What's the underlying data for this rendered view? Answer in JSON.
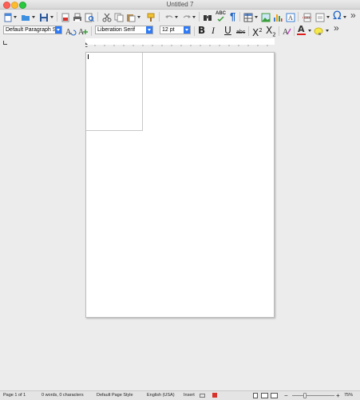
{
  "window": {
    "title": "Untitled 7"
  },
  "toolbar2": {
    "paragraph_style": "Default Paragraph S",
    "font_name": "Liberation Serif",
    "font_size": "12 pt",
    "bold": "B",
    "italic": "I",
    "underline": "U",
    "strikethrough": "abc",
    "superscript": "X",
    "superscript_mark": "2",
    "subscript": "X",
    "subscript_mark": "2",
    "font_color": "A",
    "overflow": "»"
  },
  "toolbar1": {
    "overflow": "»",
    "special_char": "Ω",
    "spelling": "ABC",
    "pilcrow": "¶"
  },
  "statusbar": {
    "page": "Page 1 of 1",
    "words": "0 words, 0 characters",
    "page_style": "Default Page Style",
    "language": "English (USA)",
    "insert_mode": "Insert",
    "zoom": "75%",
    "zoom_minus": "−",
    "zoom_plus": "+"
  },
  "colors": {
    "accent": "#2f7bf6",
    "font_color": "#e02020",
    "highlight": "#f5e94a"
  }
}
